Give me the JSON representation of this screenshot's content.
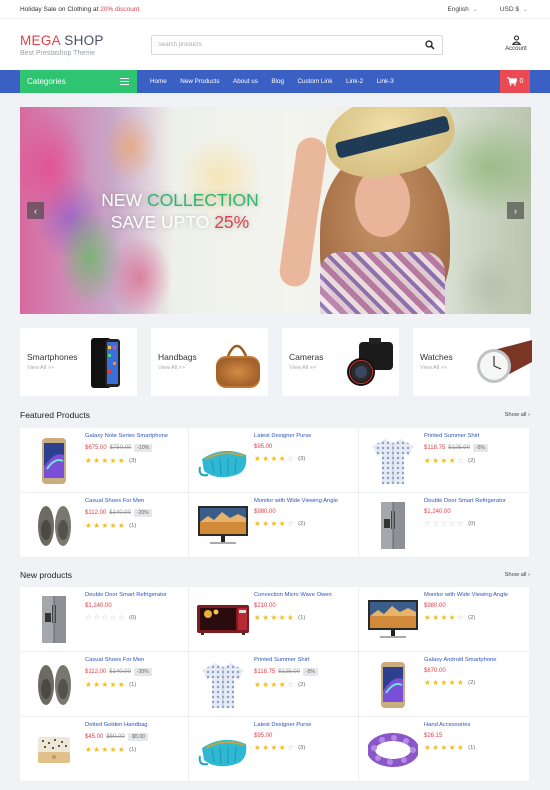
{
  "topbar": {
    "promo_prefix": "Holiday Sale on Clothing at ",
    "promo_highlight": "20% discount",
    "language": "English",
    "currency": "USD $"
  },
  "header": {
    "logo_part1": "MEGA",
    "logo_part2": " SHOP",
    "tagline": "Best Prestashop Theme",
    "search_placeholder": "Search products",
    "account_label": "Account"
  },
  "nav": {
    "categories_label": "Categories",
    "links": [
      "Home",
      "New Products",
      "About us",
      "Blog",
      "Custom Link",
      "Link-2",
      "Link-3"
    ],
    "cart_count": "0"
  },
  "slider": {
    "line1_white": "NEW ",
    "line1_green": "COLLECTION",
    "line2_white": "SAVE UPTO ",
    "line2_red": "25%",
    "prev_label": "‹",
    "next_label": "›"
  },
  "categories": [
    {
      "title": "Smartphones",
      "link": "View All  >>",
      "icon": "smartphone"
    },
    {
      "title": "Handbags",
      "link": "View All  >>",
      "icon": "handbag"
    },
    {
      "title": "Cameras",
      "link": "View All  >>",
      "icon": "camera"
    },
    {
      "title": "Watches",
      "link": "View All  >>",
      "icon": "watch"
    }
  ],
  "featured": {
    "title": "Featured Products",
    "show_all": "Show all",
    "products": [
      {
        "name": "Galaxy Note Series Smartphone",
        "price": "$675.00",
        "old_price": "$750.00",
        "discount": "-10%",
        "rating": 5,
        "reviews": "(3)",
        "icon": "smartphone"
      },
      {
        "name": "Latest Designer Purse",
        "price": "$95.00",
        "old_price": "",
        "discount": "",
        "rating": 4,
        "reviews": "(3)",
        "icon": "purse"
      },
      {
        "name": "Printed Summer Shirt",
        "price": "$118.75",
        "old_price": "$125.00",
        "discount": "-5%",
        "rating": 4,
        "reviews": "(2)",
        "icon": "shirt"
      },
      {
        "name": "Casual Shoes For Men",
        "price": "$112.00",
        "old_price": "$140.00",
        "discount": "-20%",
        "rating": 5,
        "reviews": "(1)",
        "icon": "shoes"
      },
      {
        "name": "Monitor with Wide Viewing Angle",
        "price": "$980.00",
        "old_price": "",
        "discount": "",
        "rating": 4,
        "reviews": "(2)",
        "icon": "monitor"
      },
      {
        "name": "Double Door Smart Refrigerator",
        "price": "$1,240.00",
        "old_price": "",
        "discount": "",
        "rating": 0,
        "reviews": "(0)",
        "icon": "fridge"
      }
    ]
  },
  "new_products": {
    "title": "New products",
    "show_all": "Show all",
    "products": [
      {
        "name": "Double Door Smart Refrigerator",
        "price": "$1,240.00",
        "old_price": "",
        "discount": "",
        "rating": 0,
        "reviews": "(0)",
        "icon": "fridge"
      },
      {
        "name": "Convection Micro Wave Owen",
        "price": "$210.00",
        "old_price": "",
        "discount": "",
        "rating": 5,
        "reviews": "(1)",
        "icon": "microwave"
      },
      {
        "name": "Monitor with Wide Viewing Angle",
        "price": "$980.00",
        "old_price": "",
        "discount": "",
        "rating": 4,
        "reviews": "(2)",
        "icon": "monitor"
      },
      {
        "name": "Casual Shoes For Men",
        "price": "$112.00",
        "old_price": "$140.00",
        "discount": "-20%",
        "rating": 5,
        "reviews": "(1)",
        "icon": "shoes"
      },
      {
        "name": "Printed Summer Shirt",
        "price": "$118.75",
        "old_price": "$125.00",
        "discount": "-5%",
        "rating": 4,
        "reviews": "(2)",
        "icon": "shirt"
      },
      {
        "name": "Galaxy Android Smartphone",
        "price": "$670.00",
        "old_price": "",
        "discount": "",
        "rating": 5,
        "reviews": "(2)",
        "icon": "smartphone"
      },
      {
        "name": "Dotted Golden Handbag",
        "price": "$45.00",
        "old_price": "$50.00",
        "discount": "-$5.00",
        "rating": 5,
        "reviews": "(1)",
        "icon": "golden-handbag"
      },
      {
        "name": "Latest Designer Purse",
        "price": "$95.00",
        "old_price": "",
        "discount": "",
        "rating": 4,
        "reviews": "(3)",
        "icon": "purse"
      },
      {
        "name": "Hand Accessories",
        "price": "$26.15",
        "old_price": "",
        "discount": "",
        "rating": 5,
        "reviews": "(1)",
        "icon": "bracelet"
      }
    ]
  },
  "colors": {
    "brand_red": "#e0404b",
    "nav_blue": "#3b60c4",
    "categories_green": "#2ec471",
    "cart_red": "#e94a54",
    "link_blue": "#2c56b8",
    "star_gold": "#f2be1a",
    "page_bg": "#f1f2f6"
  }
}
